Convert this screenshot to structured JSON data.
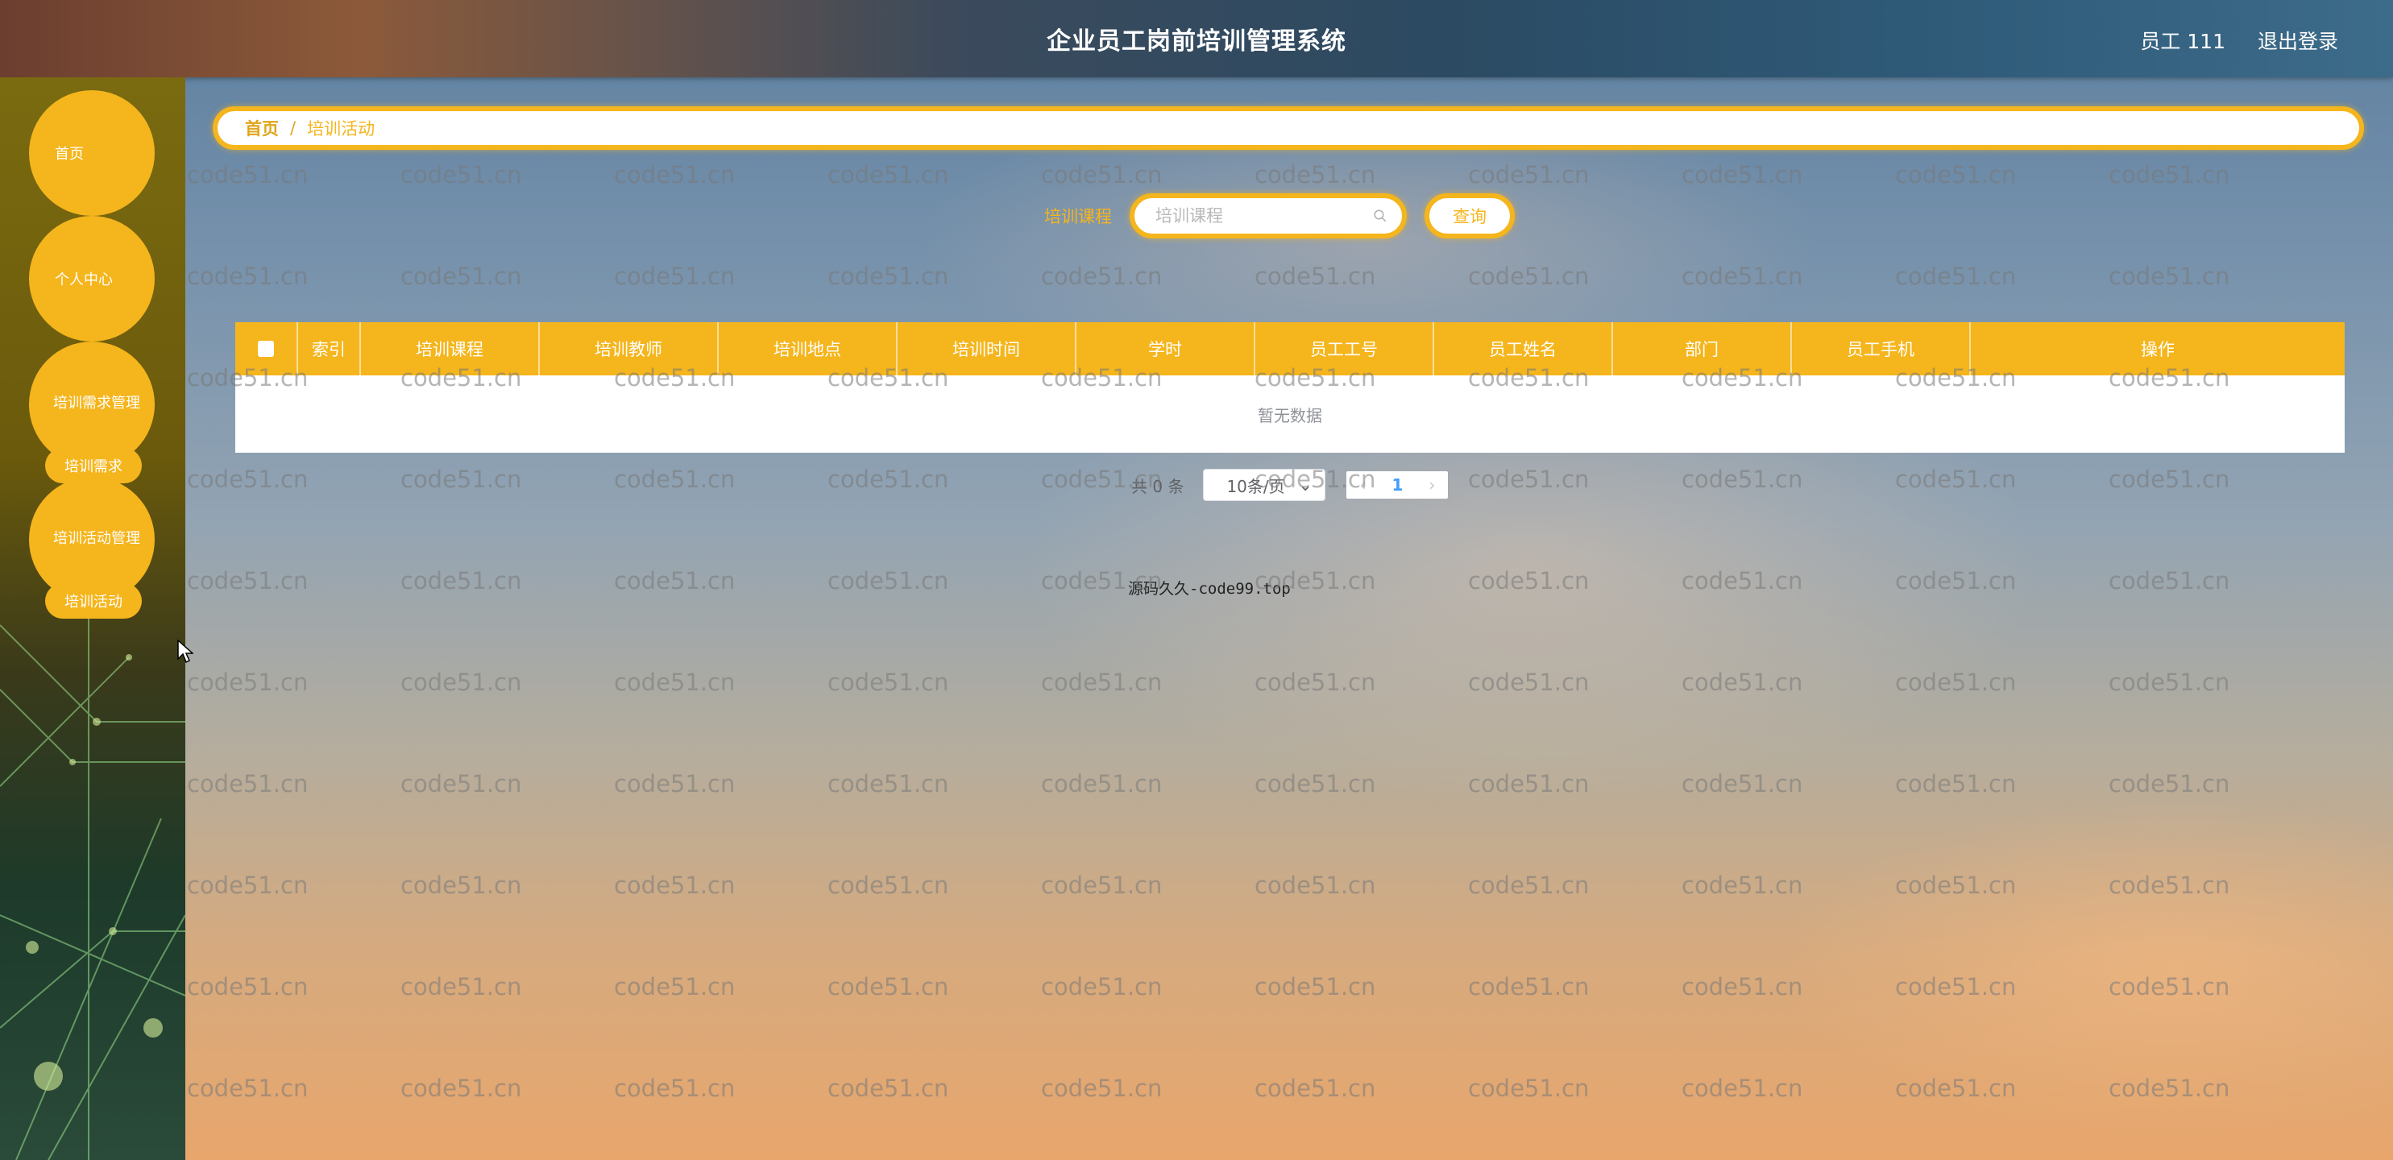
{
  "app": {
    "title": "企业员工岗前培训管理系统",
    "user_label": "员工 111",
    "logout_label": "退出登录"
  },
  "sidebar": {
    "items": [
      {
        "label": "首页"
      },
      {
        "label": "个人中心"
      },
      {
        "label": "培训需求管理",
        "sub": "培训需求"
      },
      {
        "label": "培训活动管理",
        "sub": "培训活动"
      }
    ]
  },
  "breadcrumb": {
    "home": "首页",
    "separator": "/",
    "current": "培训活动"
  },
  "search": {
    "label": "培训课程",
    "placeholder": "培训课程",
    "button_label": "查询"
  },
  "table": {
    "columns": [
      "索引",
      "培训课程",
      "培训教师",
      "培训地点",
      "培训时间",
      "学时",
      "员工工号",
      "员工姓名",
      "部门",
      "员工手机",
      "操作"
    ],
    "empty_text": "暂无数据"
  },
  "pagination": {
    "total_text": "共 0 条",
    "page_size": "10条/页",
    "current_page": "1"
  },
  "footer": {
    "text": "源码久久-code99.top"
  },
  "watermark": {
    "text": "code51.cn"
  },
  "colors": {
    "accent": "#f5b51c",
    "sidebar_bg": "#6b5a0c",
    "header_bg": "#2c4a62"
  }
}
